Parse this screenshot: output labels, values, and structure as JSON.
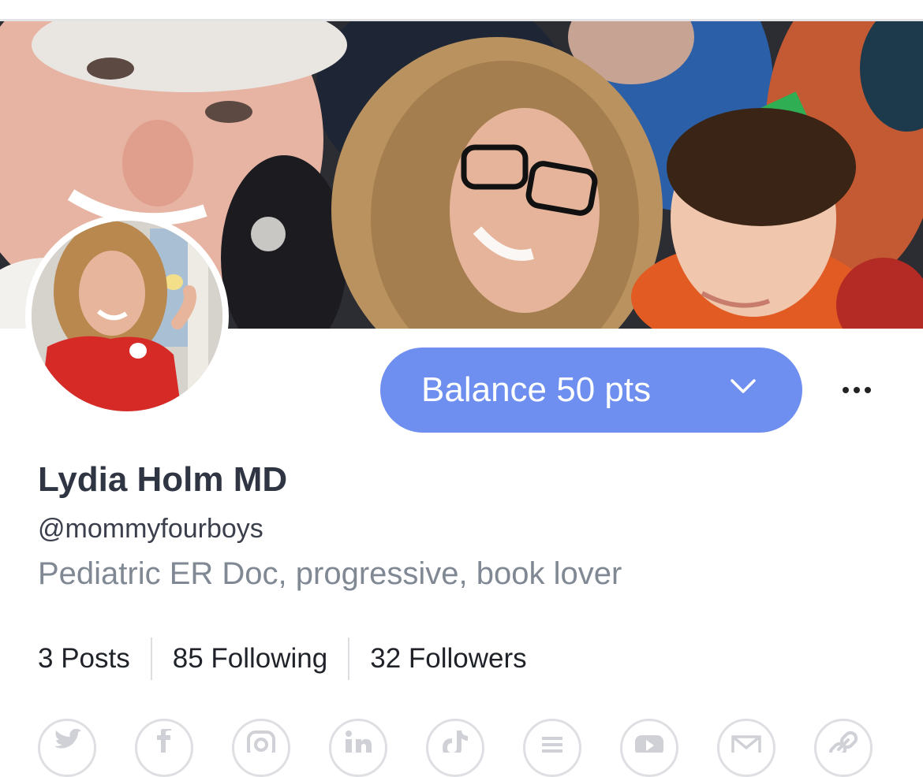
{
  "profile": {
    "name": "Lydia Holm MD",
    "handle": "@mommyfourboys",
    "bio": "Pediatric ER Doc, progressive, book lover"
  },
  "balance": {
    "label": "Balance 50 pts"
  },
  "stats": {
    "posts": "3 Posts",
    "following": "85 Following",
    "followers": "32 Followers"
  },
  "social_icons": [
    "twitter-icon",
    "facebook-icon",
    "instagram-icon",
    "linkedin-icon",
    "tiktok-icon",
    "list-icon",
    "youtube-icon",
    "email-icon",
    "link-icon"
  ],
  "colors": {
    "accent": "#6e8ff0",
    "name_text": "#2f3542",
    "bio_text": "#808894",
    "divider": "#dcdde1"
  }
}
